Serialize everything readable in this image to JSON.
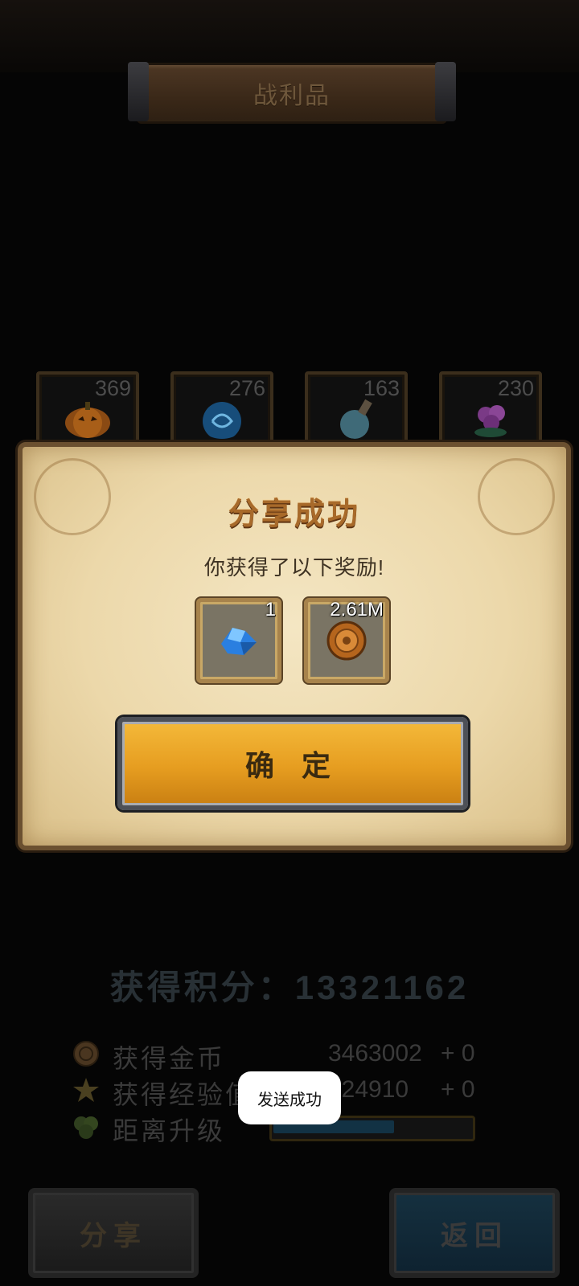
{
  "header": {
    "title": "战利品"
  },
  "loot_items": [
    {
      "count": "369",
      "icon": "pumpkin-icon",
      "color": "#d9771e"
    },
    {
      "count": "276",
      "icon": "blue-egg-icon",
      "color": "#2a7fd0"
    },
    {
      "count": "163",
      "icon": "potion-bottle-icon",
      "color": "#7fc4d8"
    },
    {
      "count": "230",
      "icon": "purple-flower-icon",
      "color": "#b05fc0"
    }
  ],
  "modal": {
    "title": "分享成功",
    "subtitle": "你获得了以下奖励!",
    "rewards": [
      {
        "count": "1",
        "icon": "blue-crystal-icon"
      },
      {
        "count": "2.61M",
        "icon": "gold-coin-icon"
      }
    ],
    "confirm_label": "确 定"
  },
  "score": {
    "text": "获得积分：13321162"
  },
  "stats": [
    {
      "icon": "coin-icon",
      "label": "获得金币",
      "value": "3463002",
      "delta": "+ 0"
    },
    {
      "icon": "star-icon",
      "label": "获得经验值",
      "value": "724910",
      "delta": "+ 0"
    },
    {
      "icon": "leaf-icon",
      "label": "距离升级",
      "value": "",
      "delta": ""
    }
  ],
  "level_progress": 0.62,
  "buttons": {
    "share_label": "分享",
    "back_label": "返回"
  },
  "toast": {
    "text": "发送成功"
  },
  "colors": {
    "accent_gold": "#e69d20",
    "parchment": "#f4e6c3",
    "back_blue": "#15303f"
  }
}
